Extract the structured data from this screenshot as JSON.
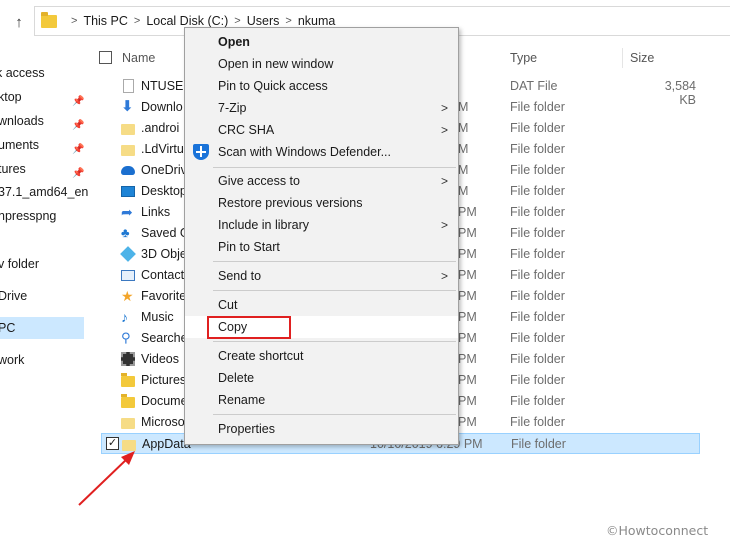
{
  "address": {
    "crumbs": [
      "This PC",
      "Local Disk (C:)",
      "Users",
      "nkuma"
    ]
  },
  "nav_pane": [
    {
      "label": "k access",
      "pinned": false
    },
    {
      "label": "ktop",
      "pinned": true
    },
    {
      "label": "wnloads",
      "pinned": true
    },
    {
      "label": "uments",
      "pinned": true
    },
    {
      "label": "tures",
      "pinned": true
    },
    {
      "label": "37.1_amd64_en-",
      "pinned": false
    },
    {
      "label": "npresspng",
      "pinned": false
    },
    {
      "label": "l",
      "pinned": false
    },
    {
      "label": "v folder",
      "pinned": false
    },
    {
      "label": "Drive",
      "pinned": false
    },
    {
      "label": "PC",
      "pinned": false,
      "selected": true
    },
    {
      "label": "work",
      "pinned": false
    }
  ],
  "columns": {
    "name": "Name",
    "type": "Type",
    "size": "Size"
  },
  "files": [
    {
      "name": "NTUSER",
      "date": "",
      "type": "DAT File",
      "size": "3,584 KB",
      "icon": "file-icon"
    },
    {
      "name": "Downlo",
      "date": "M",
      "type": "File folder",
      "size": "",
      "icon": "downloads-icon"
    },
    {
      "name": ".androi",
      "date": "M",
      "type": "File folder",
      "size": "",
      "icon": "folder-icon"
    },
    {
      "name": ".LdVirtu",
      "date": "M",
      "type": "File folder",
      "size": "",
      "icon": "folder-icon"
    },
    {
      "name": "OneDriv",
      "date": "M",
      "type": "File folder",
      "size": "",
      "icon": "onedrive-icon"
    },
    {
      "name": "Desktop",
      "date": "M",
      "type": "File folder",
      "size": "",
      "icon": "desktop-icon"
    },
    {
      "name": "Links",
      "date": "PM",
      "type": "File folder",
      "size": "",
      "icon": "links-icon"
    },
    {
      "name": "Saved G",
      "date": "PM",
      "type": "File folder",
      "size": "",
      "icon": "saved-games-icon"
    },
    {
      "name": "3D Obje",
      "date": "PM",
      "type": "File folder",
      "size": "",
      "icon": "3d-objects-icon"
    },
    {
      "name": "Contact",
      "date": "PM",
      "type": "File folder",
      "size": "",
      "icon": "contacts-icon"
    },
    {
      "name": "Favorite",
      "date": "PM",
      "type": "File folder",
      "size": "",
      "icon": "favorites-icon"
    },
    {
      "name": "Music",
      "date": "PM",
      "type": "File folder",
      "size": "",
      "icon": "music-icon"
    },
    {
      "name": "Searche",
      "date": "PM",
      "type": "File folder",
      "size": "",
      "icon": "searches-icon"
    },
    {
      "name": "Videos",
      "date": "PM",
      "type": "File folder",
      "size": "",
      "icon": "videos-icon"
    },
    {
      "name": "Pictures",
      "date": "PM",
      "type": "File folder",
      "size": "",
      "icon": "pictures-icon"
    },
    {
      "name": "Docume",
      "date": "PM",
      "type": "File folder",
      "size": "",
      "icon": "documents-icon"
    },
    {
      "name": "Microso",
      "date": "PM",
      "type": "File folder",
      "size": "",
      "icon": "folder-icon"
    },
    {
      "name": "AppData",
      "date": "10/10/2019 6:29 PM",
      "type": "File folder",
      "size": "",
      "icon": "folder-icon",
      "selected": true,
      "checked": true
    }
  ],
  "context_menu": {
    "open": "Open",
    "open_new_window": "Open in new window",
    "pin_quick_access": "Pin to Quick access",
    "seven_zip": "7-Zip",
    "crc_sha": "CRC SHA",
    "scan_defender": "Scan with Windows Defender...",
    "give_access": "Give access to",
    "restore_versions": "Restore previous versions",
    "include_library": "Include in library",
    "pin_start": "Pin to Start",
    "send_to": "Send to",
    "cut": "Cut",
    "copy": "Copy",
    "create_shortcut": "Create shortcut",
    "delete": "Delete",
    "rename": "Rename",
    "properties": "Properties"
  },
  "annotations": {
    "highlight_color": "#e02020"
  },
  "watermark": "©Howtoconnect"
}
